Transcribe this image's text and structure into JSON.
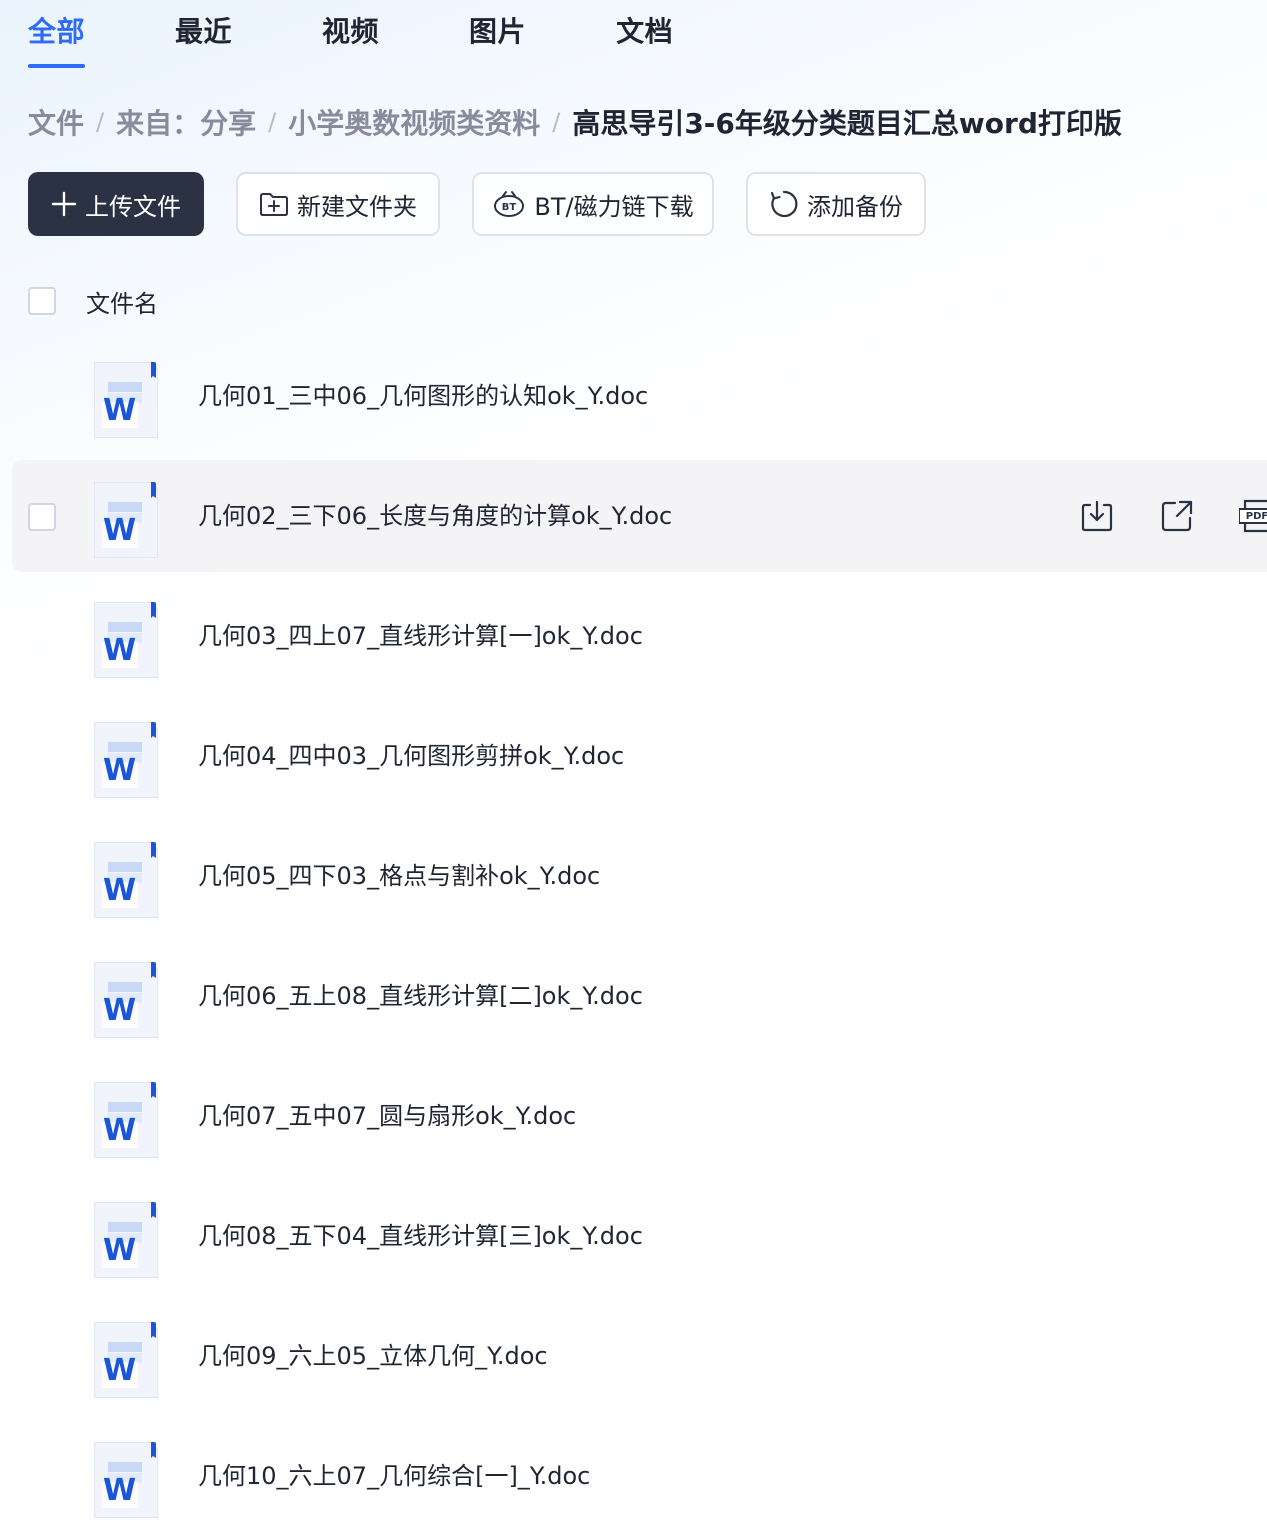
{
  "tabs": [
    {
      "label": "全部",
      "active": true
    },
    {
      "label": "最近",
      "active": false
    },
    {
      "label": "视频",
      "active": false
    },
    {
      "label": "图片",
      "active": false
    },
    {
      "label": "文档",
      "active": false
    }
  ],
  "breadcrumb": {
    "separator": "/",
    "items": [
      "文件",
      "来自：分享",
      "小学奥数视频类资料",
      "高思导引3-6年级分类题目汇总word打印版"
    ]
  },
  "toolbar": {
    "upload_label": "上传文件",
    "new_folder_label": "新建文件夹",
    "bt_label": "BT/磁力链下载",
    "backup_label": "添加备份"
  },
  "list": {
    "header_label": "文件名",
    "icon_letter": "W",
    "files": [
      {
        "name": "几何01_三中06_几何图形的认知ok_Y.doc",
        "icon": "word-doc-icon",
        "hovered": false
      },
      {
        "name": "几何02_三下06_长度与角度的计算ok_Y.doc",
        "icon": "word-doc-icon",
        "hovered": true
      },
      {
        "name": "几何03_四上07_直线形计算[一]ok_Y.doc",
        "icon": "word-doc-icon",
        "hovered": false
      },
      {
        "name": "几何04_四中03_几何图形剪拼ok_Y.doc",
        "icon": "word-doc-icon",
        "hovered": false
      },
      {
        "name": "几何05_四下03_格点与割补ok_Y.doc",
        "icon": "word-doc-icon",
        "hovered": false
      },
      {
        "name": "几何06_五上08_直线形计算[二]ok_Y.doc",
        "icon": "word-doc-icon",
        "hovered": false
      },
      {
        "name": "几何07_五中07_圆与扇形ok_Y.doc",
        "icon": "word-doc-icon",
        "hovered": false
      },
      {
        "name": "几何08_五下04_直线形计算[三]ok_Y.doc",
        "icon": "word-doc-icon",
        "hovered": false
      },
      {
        "name": "几何09_六上05_立体几何_Y.doc",
        "icon": "word-doc-icon",
        "hovered": false
      },
      {
        "name": "几何10_六上07_几何综合[一]_Y.doc",
        "icon": "word-doc-icon",
        "hovered": false
      }
    ]
  },
  "row_actions": [
    {
      "name": "download-icon"
    },
    {
      "name": "share-icon"
    },
    {
      "name": "pdf-convert-icon",
      "text": "PDF"
    }
  ],
  "colors": {
    "accent": "#2e6bf6",
    "primary_button": "#2b3244",
    "word_blue": "#1a56d6",
    "text": "#1f2533",
    "muted": "#878c9c",
    "hover_row": "#f4f4f6"
  }
}
